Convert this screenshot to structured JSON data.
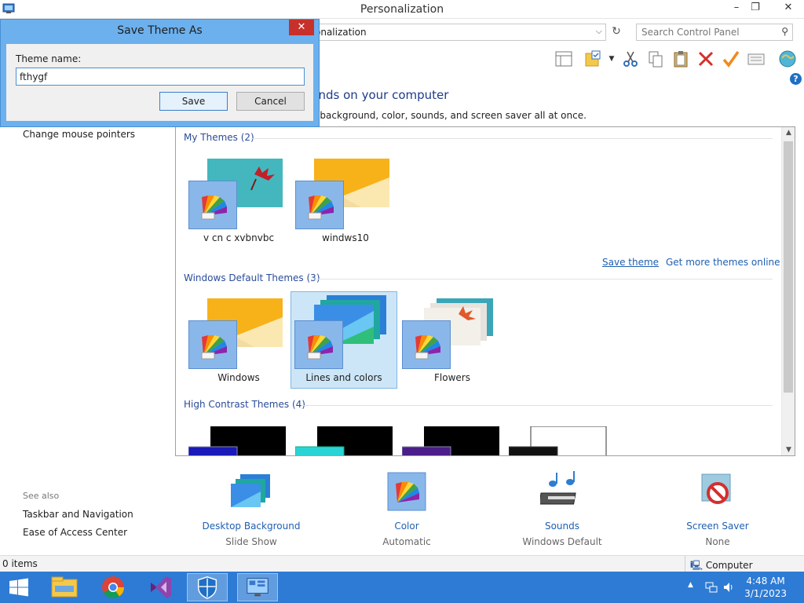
{
  "window": {
    "title": "Personalization",
    "minimize": "–",
    "maximize": "❐",
    "close": "✕"
  },
  "address": {
    "text": "onalization",
    "search_placeholder": "Search Control Panel"
  },
  "header": {
    "heading": "unds on your computer",
    "subheading": "p background, color, sounds, and screen saver all at once."
  },
  "left": {
    "change_mouse_pointers": "Change mouse pointers",
    "see_also": "See also",
    "taskbar_navigation": "Taskbar and Navigation",
    "ease_of_access": "Ease of Access Center"
  },
  "themes": {
    "my_themes_header": "My Themes (2)",
    "my_themes": [
      {
        "label": "v cn c xvbnvbc"
      },
      {
        "label": "windws10"
      }
    ],
    "save_theme": "Save theme",
    "get_more": "Get more themes online",
    "default_header": "Windows Default Themes (3)",
    "default_themes": [
      {
        "label": "Windows"
      },
      {
        "label": "Lines and colors"
      },
      {
        "label": "Flowers"
      }
    ],
    "high_contrast_header": "High Contrast Themes (4)"
  },
  "options": [
    {
      "name": "Desktop Background",
      "value": "Slide Show"
    },
    {
      "name": "Color",
      "value": "Automatic"
    },
    {
      "name": "Sounds",
      "value": "Windows Default"
    },
    {
      "name": "Screen Saver",
      "value": "None"
    }
  ],
  "status": {
    "items": "0 items",
    "computer": "Computer"
  },
  "taskbar": {
    "time": "4:48 AM",
    "date": "3/1/2023"
  },
  "dialog": {
    "title": "Save Theme As",
    "close": "✕",
    "label": "Theme name:",
    "value": "fthygf",
    "save": "Save",
    "cancel": "Cancel"
  },
  "colors": {
    "accent": "#2d7bd5",
    "link": "#1f5fb0",
    "dialog_frame": "#6cb0ed",
    "close_red": "#c7302b",
    "selection": "#cde6f7"
  }
}
